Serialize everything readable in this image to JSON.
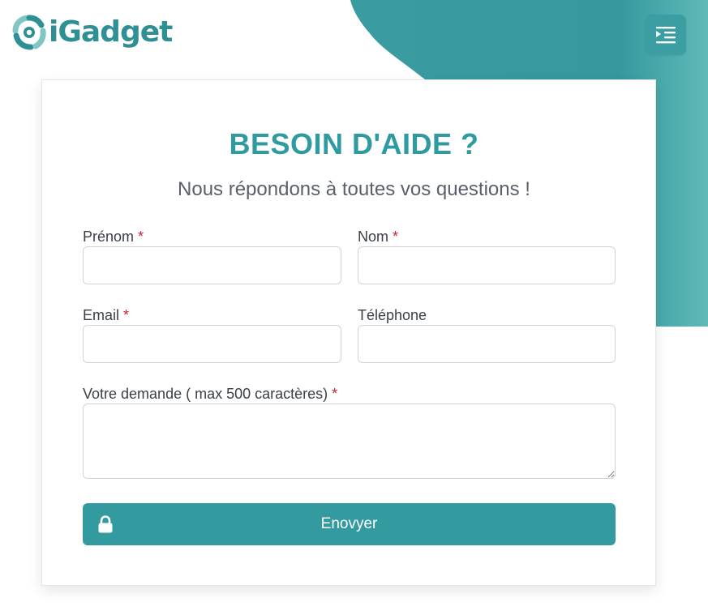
{
  "brand": {
    "name": "iGadget",
    "accent": "#2f9aa0",
    "button": "#339ba0"
  },
  "header": {
    "menu_icon": "menu-indent-icon"
  },
  "form": {
    "title": "BESOIN D'AIDE ?",
    "subtitle": "Nous répondons à toutes vos questions !",
    "required_mark": "*",
    "fields": {
      "prenom": {
        "label": "Prénom",
        "value": "",
        "required": true
      },
      "nom": {
        "label": "Nom",
        "value": "",
        "required": true
      },
      "email": {
        "label": "Email",
        "value": "",
        "required": true
      },
      "telephone": {
        "label": "Téléphone",
        "value": "",
        "required": false
      },
      "demande": {
        "label": "Votre demande ( max 500 caractères)",
        "value": "",
        "required": true
      }
    },
    "submit": {
      "label": "Enovyer",
      "icon": "lock-icon"
    }
  }
}
